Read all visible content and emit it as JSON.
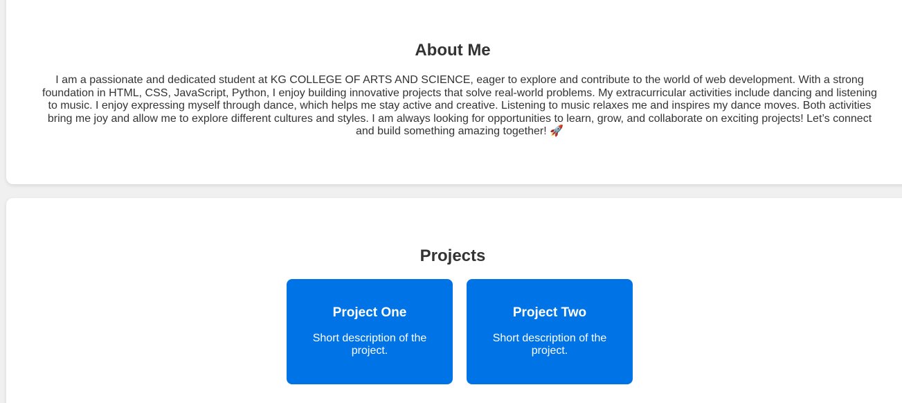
{
  "about": {
    "title": "About Me",
    "text": "I am a passionate and dedicated student at KG COLLEGE OF ARTS AND SCIENCE, eager to explore and contribute to the world of web development. With a strong foundation in HTML, CSS, JavaScript, Python, I enjoy building innovative projects that solve real-world problems. My extracurricular activities include dancing and listening to music. I enjoy expressing myself through dance, which helps me stay active and creative. Listening to music relaxes me and inspires my dance moves. Both activities bring me joy and allow me to explore different cultures and styles. I am always looking for opportunities to learn, grow, and collaborate on exciting projects! Let’s connect and build something amazing together! 🚀"
  },
  "projects": {
    "title": "Projects",
    "items": [
      {
        "title": "Project One",
        "description": "Short description of the project."
      },
      {
        "title": "Project Two",
        "description": "Short description of the project."
      }
    ]
  },
  "colors": {
    "page_background": "#f0f0f0",
    "card_background": "#ffffff",
    "text": "#333333",
    "project_card": "#0073e6",
    "project_text": "#ffffff"
  }
}
